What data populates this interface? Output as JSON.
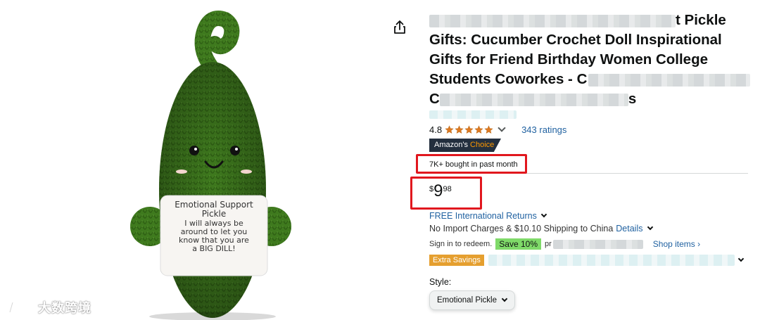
{
  "product": {
    "title_line1_tail": "t Pickle",
    "title_line2": "Gifts: Cucumber Crochet Doll Inspirational",
    "title_line3": "Gifts for Friend Birthday Women College",
    "title_line4_head": "Students Coworkes - C",
    "title_line5_head": "C",
    "title_line5_tail": "s"
  },
  "rating": {
    "value": "4.8",
    "stars": 5,
    "count_text": "343 ratings",
    "star_color": "#de7921"
  },
  "badge": {
    "prefix": "Amazon's",
    "suffix": "Choice"
  },
  "bought_text": "7K+ bought in past month",
  "price": {
    "symbol": "$",
    "whole": "9",
    "fraction": "98"
  },
  "shipping": {
    "returns_text": "FREE International Returns",
    "import_text": "No Import Charges & $10.10 Shipping to China",
    "details_link": "Details"
  },
  "promo": {
    "signin_text": "Sign in to redeem.",
    "save_chip": "Save 10%",
    "partial_text": "pr",
    "shop_items": "Shop items ›"
  },
  "extra_savings": "Extra Savings",
  "style": {
    "label": "Style:",
    "selected": "Emotional Pickle"
  },
  "image_card": {
    "heading_line1": "Emotional Support",
    "heading_line2": "Pickle",
    "body_line1": "I will always be",
    "body_line2": "around to let you",
    "body_line3": "know that you are",
    "body_line4": "a BIG DILL!"
  },
  "watermark_text": "大数跨境",
  "colors": {
    "link": "#2162a1",
    "highlight_box": "#e1171e",
    "pickle_green": "#3f7a1e"
  }
}
